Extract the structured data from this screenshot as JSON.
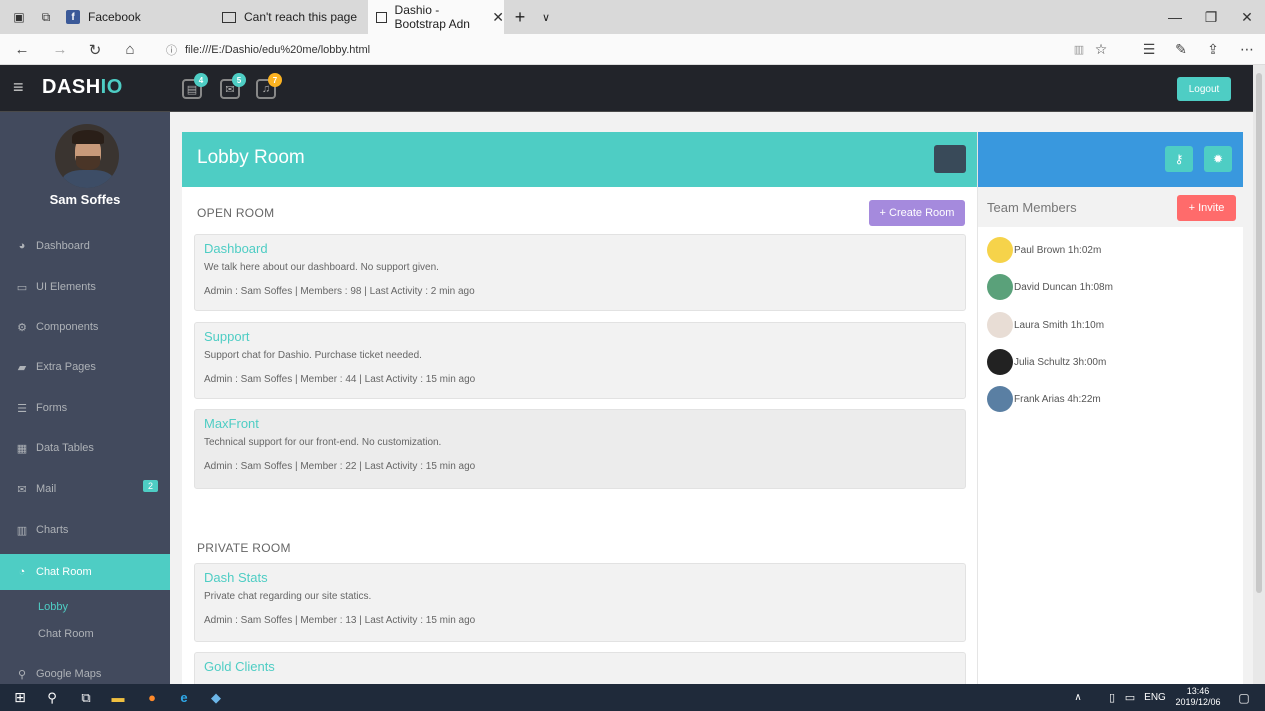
{
  "browser": {
    "tabs": [
      {
        "label": "Facebook"
      },
      {
        "label": "Can't reach this page"
      },
      {
        "label": "Dashio - Bootstrap Adn"
      }
    ],
    "url": "file:///E:/Dashio/edu%20me/lobby.html"
  },
  "app": {
    "logo_main": "DASH",
    "logo_accent": "IO",
    "notifications": [
      {
        "icon": "tasks-icon",
        "count": "4",
        "color": "#4ecdc4"
      },
      {
        "icon": "mail-icon",
        "count": "5",
        "color": "#4ecdc4"
      },
      {
        "icon": "bell-icon",
        "count": "7",
        "color": "#fcb322"
      }
    ],
    "logout_label": "Logout"
  },
  "sidebar": {
    "username": "Sam Soffes",
    "items": [
      {
        "label": "Dashboard",
        "icon": "dashboard-icon"
      },
      {
        "label": "UI Elements",
        "icon": "desktop-icon"
      },
      {
        "label": "Components",
        "icon": "cogs-icon"
      },
      {
        "label": "Extra Pages",
        "icon": "book-icon"
      },
      {
        "label": "Forms",
        "icon": "tasks-icon"
      },
      {
        "label": "Data Tables",
        "icon": "th-icon"
      },
      {
        "label": "Mail",
        "icon": "envelope-icon",
        "badge": "2"
      },
      {
        "label": "Charts",
        "icon": "bar-chart-icon"
      },
      {
        "label": "Chat Room",
        "icon": "comments-icon"
      },
      {
        "label": "Google Maps",
        "icon": "map-marker-icon"
      }
    ],
    "submenu": [
      {
        "label": "Lobby"
      },
      {
        "label": "Chat Room"
      }
    ]
  },
  "lobby": {
    "title": "Lobby Room",
    "open_label": "OPEN ROOM",
    "create_label": "+ Create Room",
    "private_label": "PRIVATE ROOM",
    "open_rooms": [
      {
        "name": "Dashboard",
        "desc": "We talk here about our dashboard. No support given.",
        "meta": "Admin : Sam Soffes | Members : 98 | Last Activity : 2 min ago"
      },
      {
        "name": "Support",
        "desc": "Support chat for Dashio. Purchase ticket needed.",
        "meta": "Admin : Sam Soffes | Member : 44 | Last Activity : 15 min ago"
      },
      {
        "name": "MaxFront",
        "desc": "Technical support for our front-end. No customization.",
        "meta": "Admin : Sam Soffes | Member : 22 | Last Activity : 15 min ago"
      }
    ],
    "private_rooms": [
      {
        "name": "Dash Stats",
        "desc": "Private chat regarding our site statics.",
        "meta": "Admin : Sam Soffes | Member : 13 | Last Activity : 15 min ago"
      },
      {
        "name": "Gold Clients",
        "desc": "",
        "meta": ""
      }
    ]
  },
  "team": {
    "title": "Team Members",
    "invite_label": "+ Invite",
    "members": [
      {
        "name": "Paul Brown 1h:02m"
      },
      {
        "name": "David Duncan 1h:08m"
      },
      {
        "name": "Laura Smith 1h:10m"
      },
      {
        "name": "Julia Schultz 3h:00m"
      },
      {
        "name": "Frank Arias 4h:22m"
      }
    ]
  },
  "taskbar": {
    "lang": "ENG",
    "time": "13:46",
    "date": "2019/12/06"
  },
  "colors": {
    "accent": "#4ecdc4",
    "sidebar": "#424a5d",
    "header": "#22242a",
    "team_header": "#3998de",
    "create_button": "#a58add",
    "invite_button": "#ff6b6b"
  }
}
